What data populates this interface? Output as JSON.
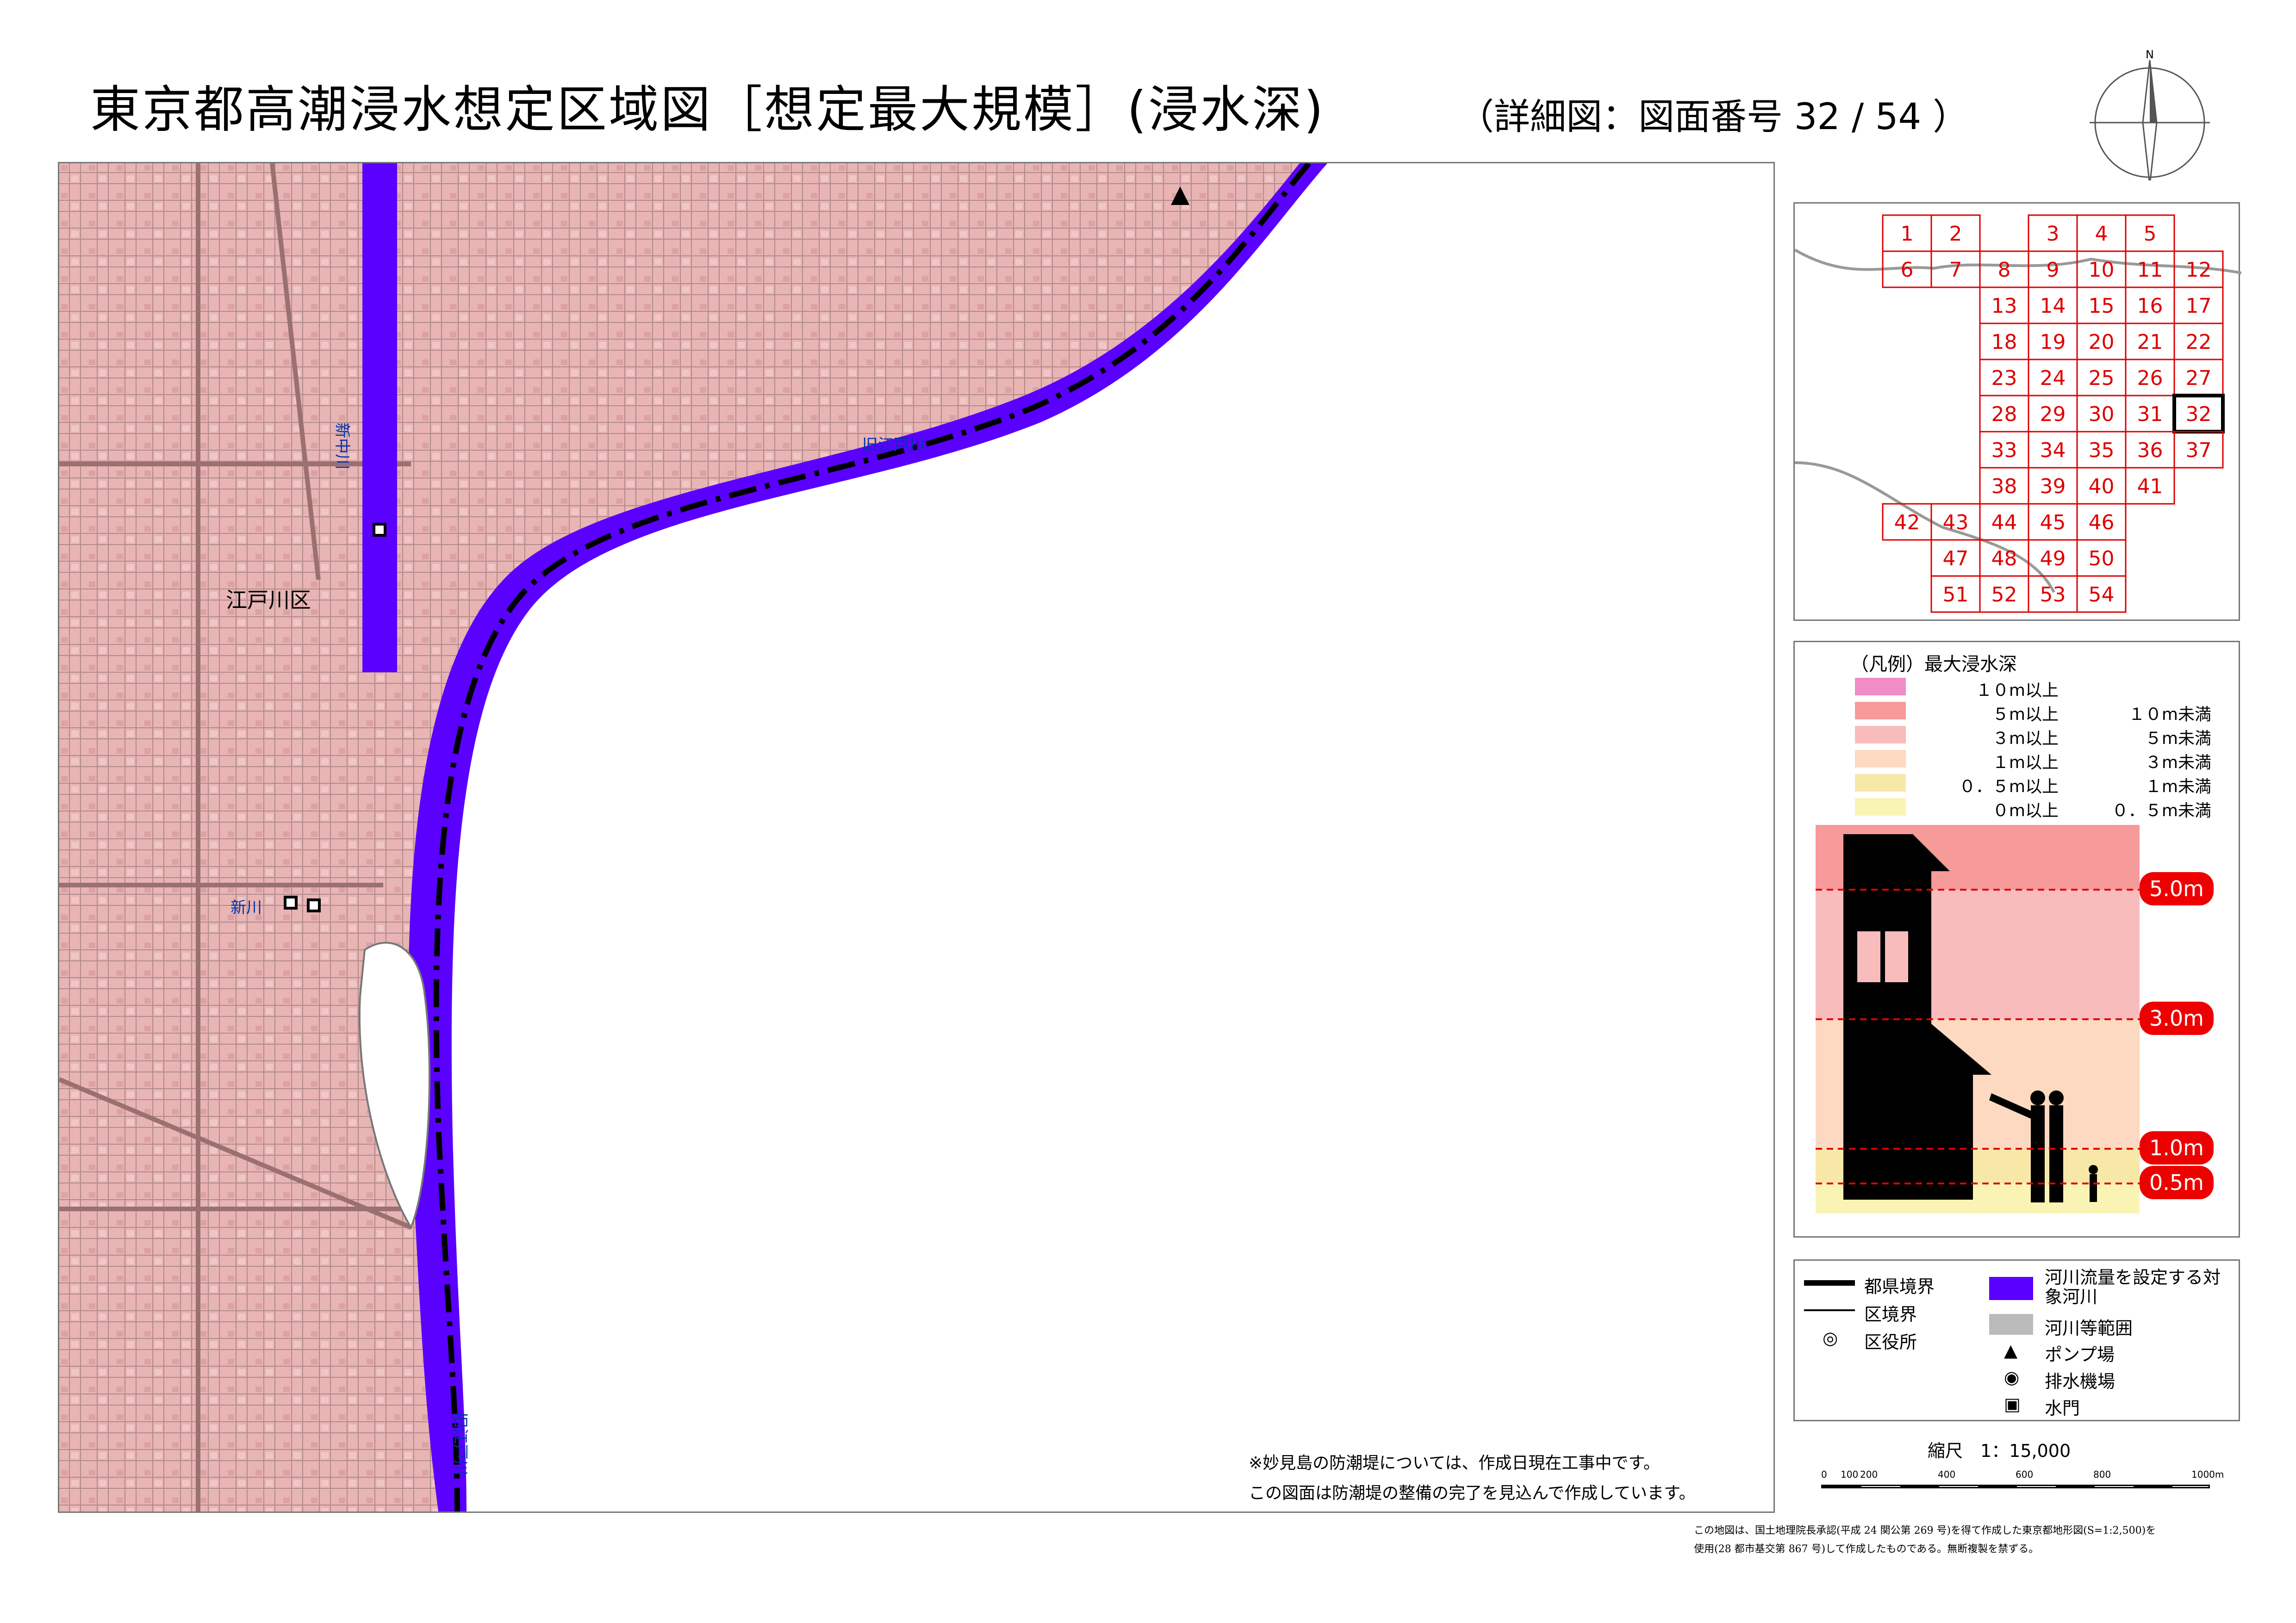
{
  "title": "東京都高潮浸水想定区域図［想定最大規模］(浸水深)",
  "subtitle": "（詳細図：図面番号 32 / 54 ）",
  "north_label": "N",
  "map": {
    "ward_label": "江戸川区",
    "river_labels": [
      "新中川",
      "旧江戸川",
      "新川",
      "旧江戸川"
    ],
    "notes": [
      "※妙見島の防潮堤については、作成日現在工事中です。",
      "この図面は防潮堤の整備の完了を見込んで作成しています。"
    ]
  },
  "index_map": {
    "current_sheet": "32",
    "sheets": [
      "1",
      "2",
      "3",
      "4",
      "5",
      "6",
      "7",
      "8",
      "9",
      "10",
      "11",
      "12",
      "13",
      "14",
      "15",
      "16",
      "17",
      "18",
      "19",
      "20",
      "21",
      "22",
      "23",
      "24",
      "25",
      "26",
      "27",
      "28",
      "29",
      "30",
      "31",
      "32",
      "33",
      "34",
      "35",
      "36",
      "37",
      "38",
      "39",
      "40",
      "41",
      "42",
      "43",
      "44",
      "45",
      "46",
      "47",
      "48",
      "49",
      "50",
      "51",
      "52",
      "53",
      "54"
    ]
  },
  "legend": {
    "title": "（凡例）最大浸水深",
    "rows": [
      {
        "from": "１０m以上",
        "to": "",
        "color": "#f08cc8"
      },
      {
        "from": "５m以上",
        "to": "１０m未満",
        "color": "#f79a9a"
      },
      {
        "from": "３m以上",
        "to": "５m未満",
        "color": "#f9bcbc"
      },
      {
        "from": "１m以上",
        "to": "３m未満",
        "color": "#fcd9c0"
      },
      {
        "from": "０．５m以上",
        "to": "１m未満",
        "color": "#f8e8a8"
      },
      {
        "from": "０m以上",
        "to": "０．５m未満",
        "color": "#f9f4b4"
      }
    ],
    "depth_markers": [
      "5.0m",
      "3.0m",
      "1.0m",
      "0.5m"
    ]
  },
  "symbols": {
    "left": [
      "都県境界",
      "区境界",
      "区役所"
    ],
    "right": [
      "河川流量を設定する対象河川",
      "河川等範囲",
      "ポンプ場",
      "排水機場",
      "水門"
    ],
    "river_color": "#5a00ff",
    "river_area_color": "#bbbbbb"
  },
  "scale": {
    "label": "縮尺　1：15,000",
    "ticks": [
      "0",
      "100",
      "200",
      "400",
      "600",
      "800",
      "1000m"
    ]
  },
  "credit": [
    "この地図は、国土地理院長承認(平成 24 関公第 269 号)を得て作成した東京都地形図(S=1:2,500)を",
    "使用(28 都市基交第 867 号)して作成したものである。無断複製を禁ずる。"
  ]
}
